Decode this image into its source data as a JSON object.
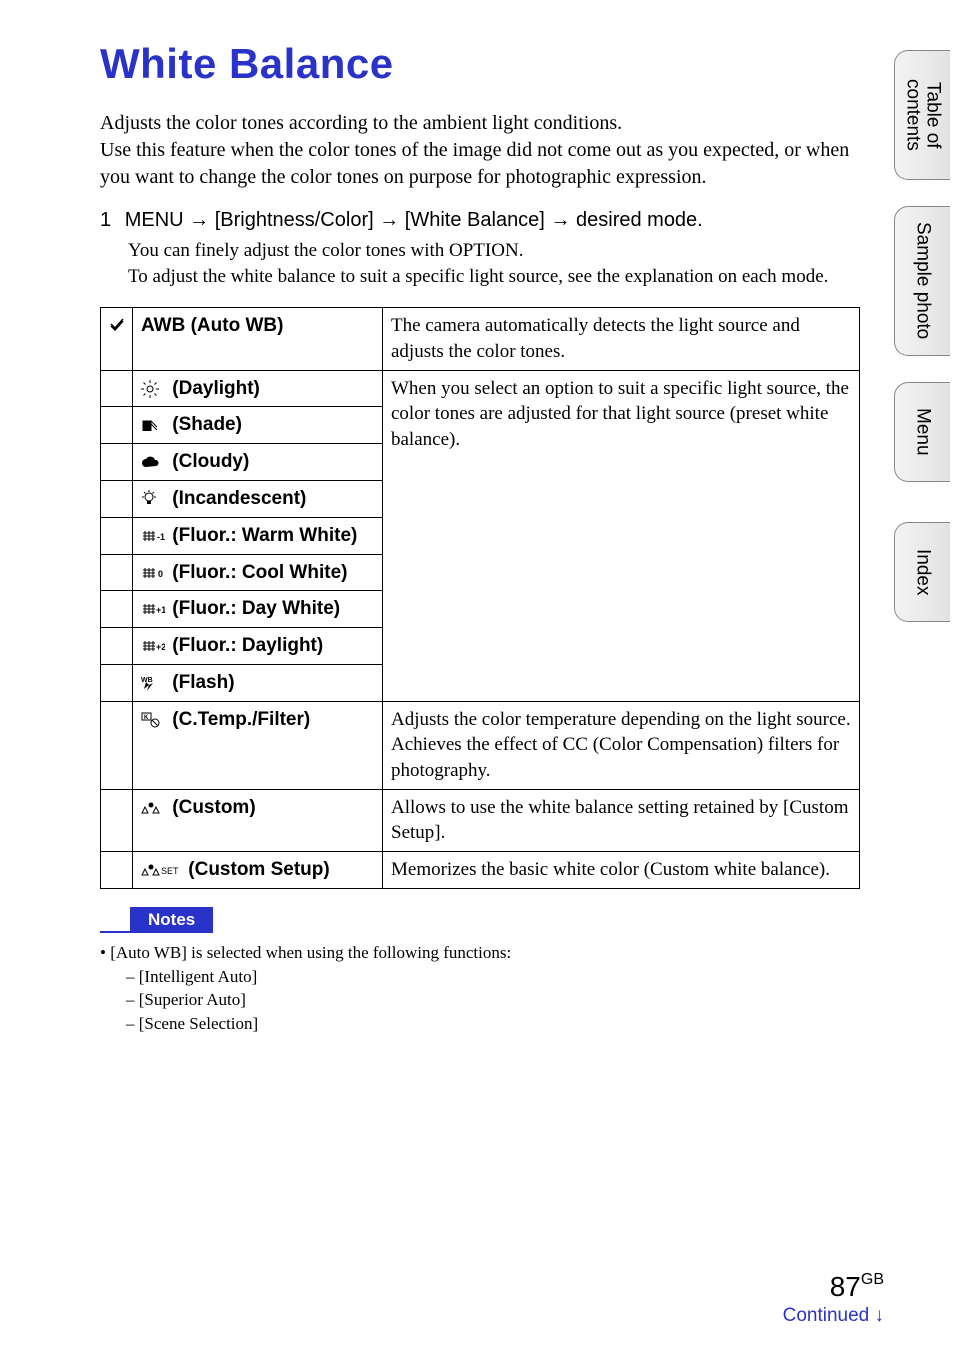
{
  "title": "White Balance",
  "intro": "Adjusts the color tones according to the ambient light conditions.\nUse this feature when the color tones of the image did not come out as you expected, or when you want to change the color tones on purpose for photographic expression.",
  "step": {
    "num": "1",
    "pre": "MENU",
    "mid1": "[Brightness/Color]",
    "mid2": "[White Balance]",
    "end": "desired mode.",
    "sub": "You can finely adjust the color tones with OPTION.\nTo adjust the white balance to suit a specific light source, see the explanation on each mode."
  },
  "table": {
    "rows": [
      {
        "label": "AWB (Auto WB)",
        "desc": "The camera automatically detects the light source and adjusts the color tones."
      },
      {
        "label": "(Daylight)"
      },
      {
        "label": "(Shade)"
      },
      {
        "label": "(Cloudy)"
      },
      {
        "label": "(Incandescent)"
      },
      {
        "label": "(Fluor.: Warm White)"
      },
      {
        "label": "(Fluor.: Cool White)"
      },
      {
        "label": "(Fluor.: Day White)"
      },
      {
        "label": "(Fluor.: Daylight)"
      },
      {
        "label": "(Flash)"
      },
      {
        "label": "(C.Temp./Filter)",
        "desc": "Adjusts the color temperature depending on the light source. Achieves the effect of CC (Color Compensation) filters for photography."
      },
      {
        "label": "(Custom)",
        "desc": "Allows to use the white balance setting retained by [Custom Setup]."
      },
      {
        "label": "(Custom Setup)",
        "desc": "Memorizes the basic white color (Custom white balance)."
      }
    ],
    "group_desc": "When you select an option to suit a specific light source, the color tones are adjusted for that light source (preset white balance)."
  },
  "notes": {
    "header": "Notes",
    "lead": "[Auto WB] is selected when using the following functions:",
    "items": [
      "[Intelligent Auto]",
      "[Superior Auto]",
      "[Scene Selection]"
    ]
  },
  "tabs": {
    "toc1": "Table of",
    "toc2": "contents",
    "sample": "Sample photo",
    "menu": "Menu",
    "index": "Index"
  },
  "footer": {
    "page": "87",
    "gb": "GB",
    "continued": "Continued ↓"
  }
}
